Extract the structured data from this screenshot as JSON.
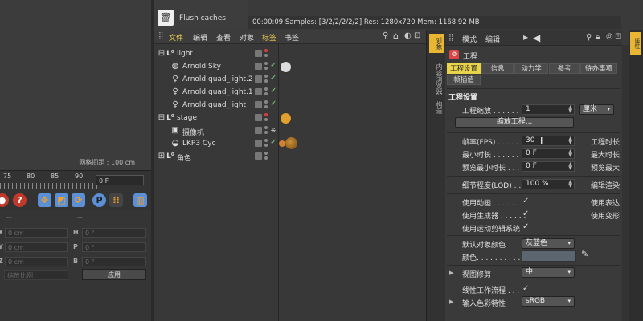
{
  "viewport": {
    "grid_label": "网格间距 : 100 cm"
  },
  "timeline": {
    "ticks": [
      "75",
      "80",
      "85",
      "90"
    ],
    "frame": "0 F"
  },
  "coords": {
    "rows": [
      {
        "l1": "X",
        "v1": "0 cm",
        "l2": "H",
        "v2": "0 °"
      },
      {
        "l1": "Y",
        "v1": "0 cm",
        "l2": "P",
        "v2": "0 °"
      },
      {
        "l1": "Z",
        "v1": "0 cm",
        "l2": "B",
        "v2": "0 °"
      }
    ],
    "dash1": "--",
    "dash2": "--",
    "scale_mode": "缩放比例",
    "apply_label": "应用"
  },
  "render": {
    "flush_label": "Flush caches",
    "status": "00:00:09  Samples: [3/2/2/2/2/2]  Res: 1280x720  Mem: 1168.92 MB"
  },
  "object_manager": {
    "menu": [
      "文件",
      "编辑",
      "查看",
      "对象",
      "标签",
      "书签"
    ],
    "objects": [
      {
        "name": "light",
        "icon": "null-icon",
        "level": 0,
        "check": false
      },
      {
        "name": "Arnold Sky",
        "icon": "sky-icon",
        "level": 1,
        "check": true
      },
      {
        "name": "Arnold quad_light.2",
        "icon": "bulb-icon",
        "level": 1,
        "check": true
      },
      {
        "name": "Arnold quad_light.1",
        "icon": "bulb-icon",
        "level": 1,
        "check": true
      },
      {
        "name": "Arnold quad_light",
        "icon": "bulb-icon",
        "level": 1,
        "check": true
      },
      {
        "name": "stage",
        "icon": "null-icon",
        "level": 0,
        "check": false
      },
      {
        "name": "摄像机",
        "icon": "camera-icon",
        "level": 1,
        "check": false
      },
      {
        "name": "LKP3 Cyc",
        "icon": "cyc-icon",
        "level": 1,
        "check": true
      },
      {
        "name": "角色",
        "icon": "null-icon",
        "level": 0,
        "check": false
      }
    ]
  },
  "side_tabs": [
    "对象",
    "内容浏览器",
    "构造"
  ],
  "attributes": {
    "menu": [
      "模式",
      "编辑"
    ],
    "title": "工程",
    "tabs_row1": [
      "工程设置",
      "信息",
      "动力学",
      "参考",
      "待办事项"
    ],
    "tabs_row2": [
      "帧插值"
    ],
    "section": "工程设置",
    "scale_label": "工程缩放 . . . . . . .",
    "scale_value": "1",
    "scale_unit": "厘米",
    "scale_button": "缩放工程...",
    "fps_label": "帧率(FPS) . . . . . .",
    "fps_value": "30",
    "min_label": "最小时长 . . . . . . .",
    "min_value": "0 F",
    "pmin_label": "预览最小时长 . . . .",
    "pmin_value": "0 F",
    "r_fps": "工程时长",
    "r_max": "最大时长",
    "r_pmax": "预览最大",
    "lod_label": "细节程度(LOD) . . .",
    "lod_value": "100 %",
    "r_lod": "编辑渲染",
    "anim_label": "使用动画 . . . . . . .",
    "gen_label": "使用生成器 . . . . . .",
    "motion_label": "使用运动剪辑系统",
    "r_expr": "使用表达",
    "r_deform": "使用变形",
    "objcolor_label": "默认对象颜色",
    "objcolor_value": "灰蓝色",
    "color_label": "颜色. . . . . . . . . .",
    "view_label": "视图修剪",
    "view_value": "中",
    "linear_label": "线性工作流程 . . .",
    "input_label": "输入色彩特性",
    "input_value": "sRGB",
    "accent": "#e8d34a"
  },
  "right_tab": "属性"
}
